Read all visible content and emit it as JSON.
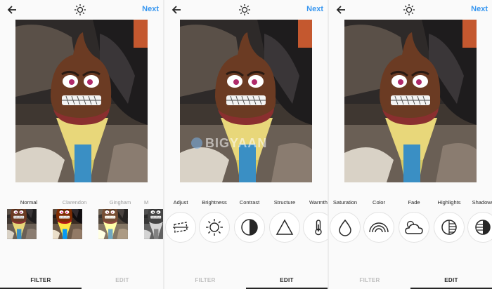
{
  "screens": [
    {
      "next_label": "Next",
      "filters": [
        {
          "label": "Normal",
          "selected": true
        },
        {
          "label": "Clarendon",
          "selected": false
        },
        {
          "label": "Gingham",
          "selected": false
        },
        {
          "label": "M",
          "selected": false
        }
      ],
      "tabs": {
        "filter": "FILTER",
        "edit": "EDIT",
        "active": "filter"
      }
    },
    {
      "next_label": "Next",
      "watermark": "BIGYAAN",
      "tools": [
        {
          "label": "Adjust",
          "icon": "adjust-icon"
        },
        {
          "label": "Brightness",
          "icon": "brightness-icon"
        },
        {
          "label": "Contrast",
          "icon": "contrast-icon"
        },
        {
          "label": "Structure",
          "icon": "structure-icon"
        },
        {
          "label": "Warmth",
          "icon": "warmth-icon"
        }
      ],
      "tabs": {
        "filter": "FILTER",
        "edit": "EDIT",
        "active": "edit"
      }
    },
    {
      "next_label": "Next",
      "tools": [
        {
          "label": "Saturation",
          "icon": "saturation-icon"
        },
        {
          "label": "Color",
          "icon": "color-icon"
        },
        {
          "label": "Fade",
          "icon": "fade-icon"
        },
        {
          "label": "Highlights",
          "icon": "highlights-icon"
        },
        {
          "label": "Shadows",
          "icon": "shadows-icon"
        }
      ],
      "tabs": {
        "filter": "FILTER",
        "edit": "EDIT",
        "active": "edit"
      }
    }
  ],
  "colors": {
    "accent": "#3897f0",
    "text": "#262626",
    "muted": "#bdbdbd"
  }
}
